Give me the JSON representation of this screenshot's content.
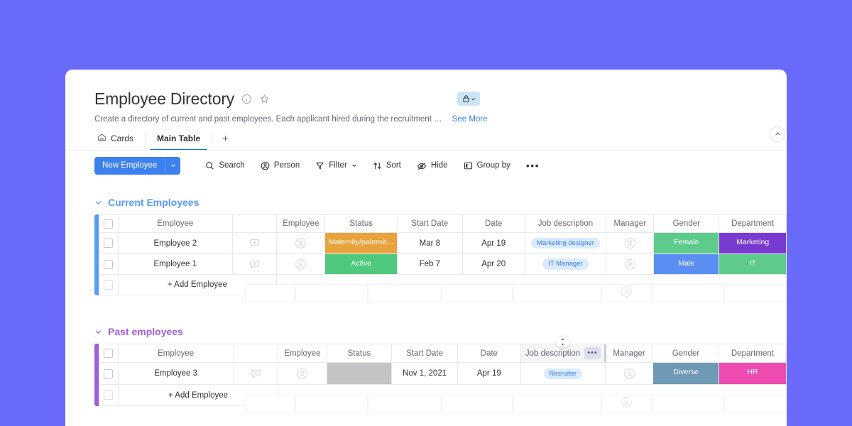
{
  "board": {
    "title": "Employee Directory",
    "description": "Create a directory of current and past employees. Each applicant hired during the recruitment …",
    "see_more": "See More",
    "info_icon": "info-icon",
    "favorite_icon": "star-icon",
    "lock_icon": "lock-icon",
    "lock_caret_icon": "chevron-down-icon",
    "collapse_icon": "chevron-up-icon"
  },
  "tabs": [
    {
      "label": "Cards",
      "icon": "home-icon",
      "active": false
    },
    {
      "label": "Main Table",
      "icon": "",
      "active": true
    }
  ],
  "tab_add_label": "+",
  "toolbar": {
    "new_item_label": "New Employee",
    "new_item_caret_icon": "chevron-down-icon",
    "items": [
      {
        "label": "Search",
        "icon": "search-icon"
      },
      {
        "label": "Person",
        "icon": "person-icon"
      },
      {
        "label": "Filter",
        "icon": "filter-icon",
        "caret": true
      },
      {
        "label": "Sort",
        "icon": "sort-icon"
      },
      {
        "label": "Hide",
        "icon": "eye-off-icon"
      },
      {
        "label": "Group by",
        "icon": "group-by-icon"
      }
    ],
    "more_label": "•••"
  },
  "columns": [
    "Employee",
    "Employee",
    "Status",
    "Start Date",
    "Date",
    "Job description",
    "Manager",
    "Gender",
    "Department"
  ],
  "groups": [
    {
      "name": "Current Employees",
      "color": "#579bfc",
      "caret_icon": "chevron-down-icon",
      "add_row_label": "+ Add Employee",
      "rows": [
        {
          "name": "Employee 2",
          "updates_icon": "add-update-icon",
          "person_icon": "person-avatar-icon",
          "status": {
            "text": "Maternity/paternit…",
            "color": "#e8a33c"
          },
          "start_date": "Mar 8",
          "date": "Apr 19",
          "job": "Marketing designer",
          "manager_icon": "person-avatar-icon",
          "gender": {
            "text": "Female",
            "color": "#5ecb8d"
          },
          "department": {
            "text": "Marketing",
            "color": "#783ad0"
          }
        },
        {
          "name": "Employee 1",
          "updates_icon": "add-update-icon",
          "person_icon": "person-avatar-icon",
          "status": {
            "text": "Active",
            "color": "#4ec97e"
          },
          "start_date": "Feb 7",
          "date": "Apr 20",
          "job": "IT Manager",
          "manager_icon": "person-avatar-icon",
          "gender": {
            "text": "Male",
            "color": "#5b8ef0"
          },
          "department": {
            "text": "IT",
            "color": "#5ecb8d"
          }
        }
      ]
    },
    {
      "name": "Past employees",
      "color": "#a25ddc",
      "caret_icon": "chevron-down-icon",
      "add_row_label": "+ Add Employee",
      "hovered_column": "Job description",
      "hovered_column_menu": "•••",
      "rows": [
        {
          "name": "Employee 3",
          "updates_icon": "add-update-icon",
          "person_icon": "person-avatar-icon",
          "status": {
            "text": "",
            "color": "#c4c4c4"
          },
          "start_date": "Nov 1, 2021",
          "date": "Apr 19",
          "job": "Recruiter",
          "manager_icon": "person-avatar-icon",
          "gender": {
            "text": "Diverse",
            "color": "#6f9ab5"
          },
          "department": {
            "text": "HR",
            "color": "#ee4bb0"
          }
        }
      ]
    }
  ]
}
